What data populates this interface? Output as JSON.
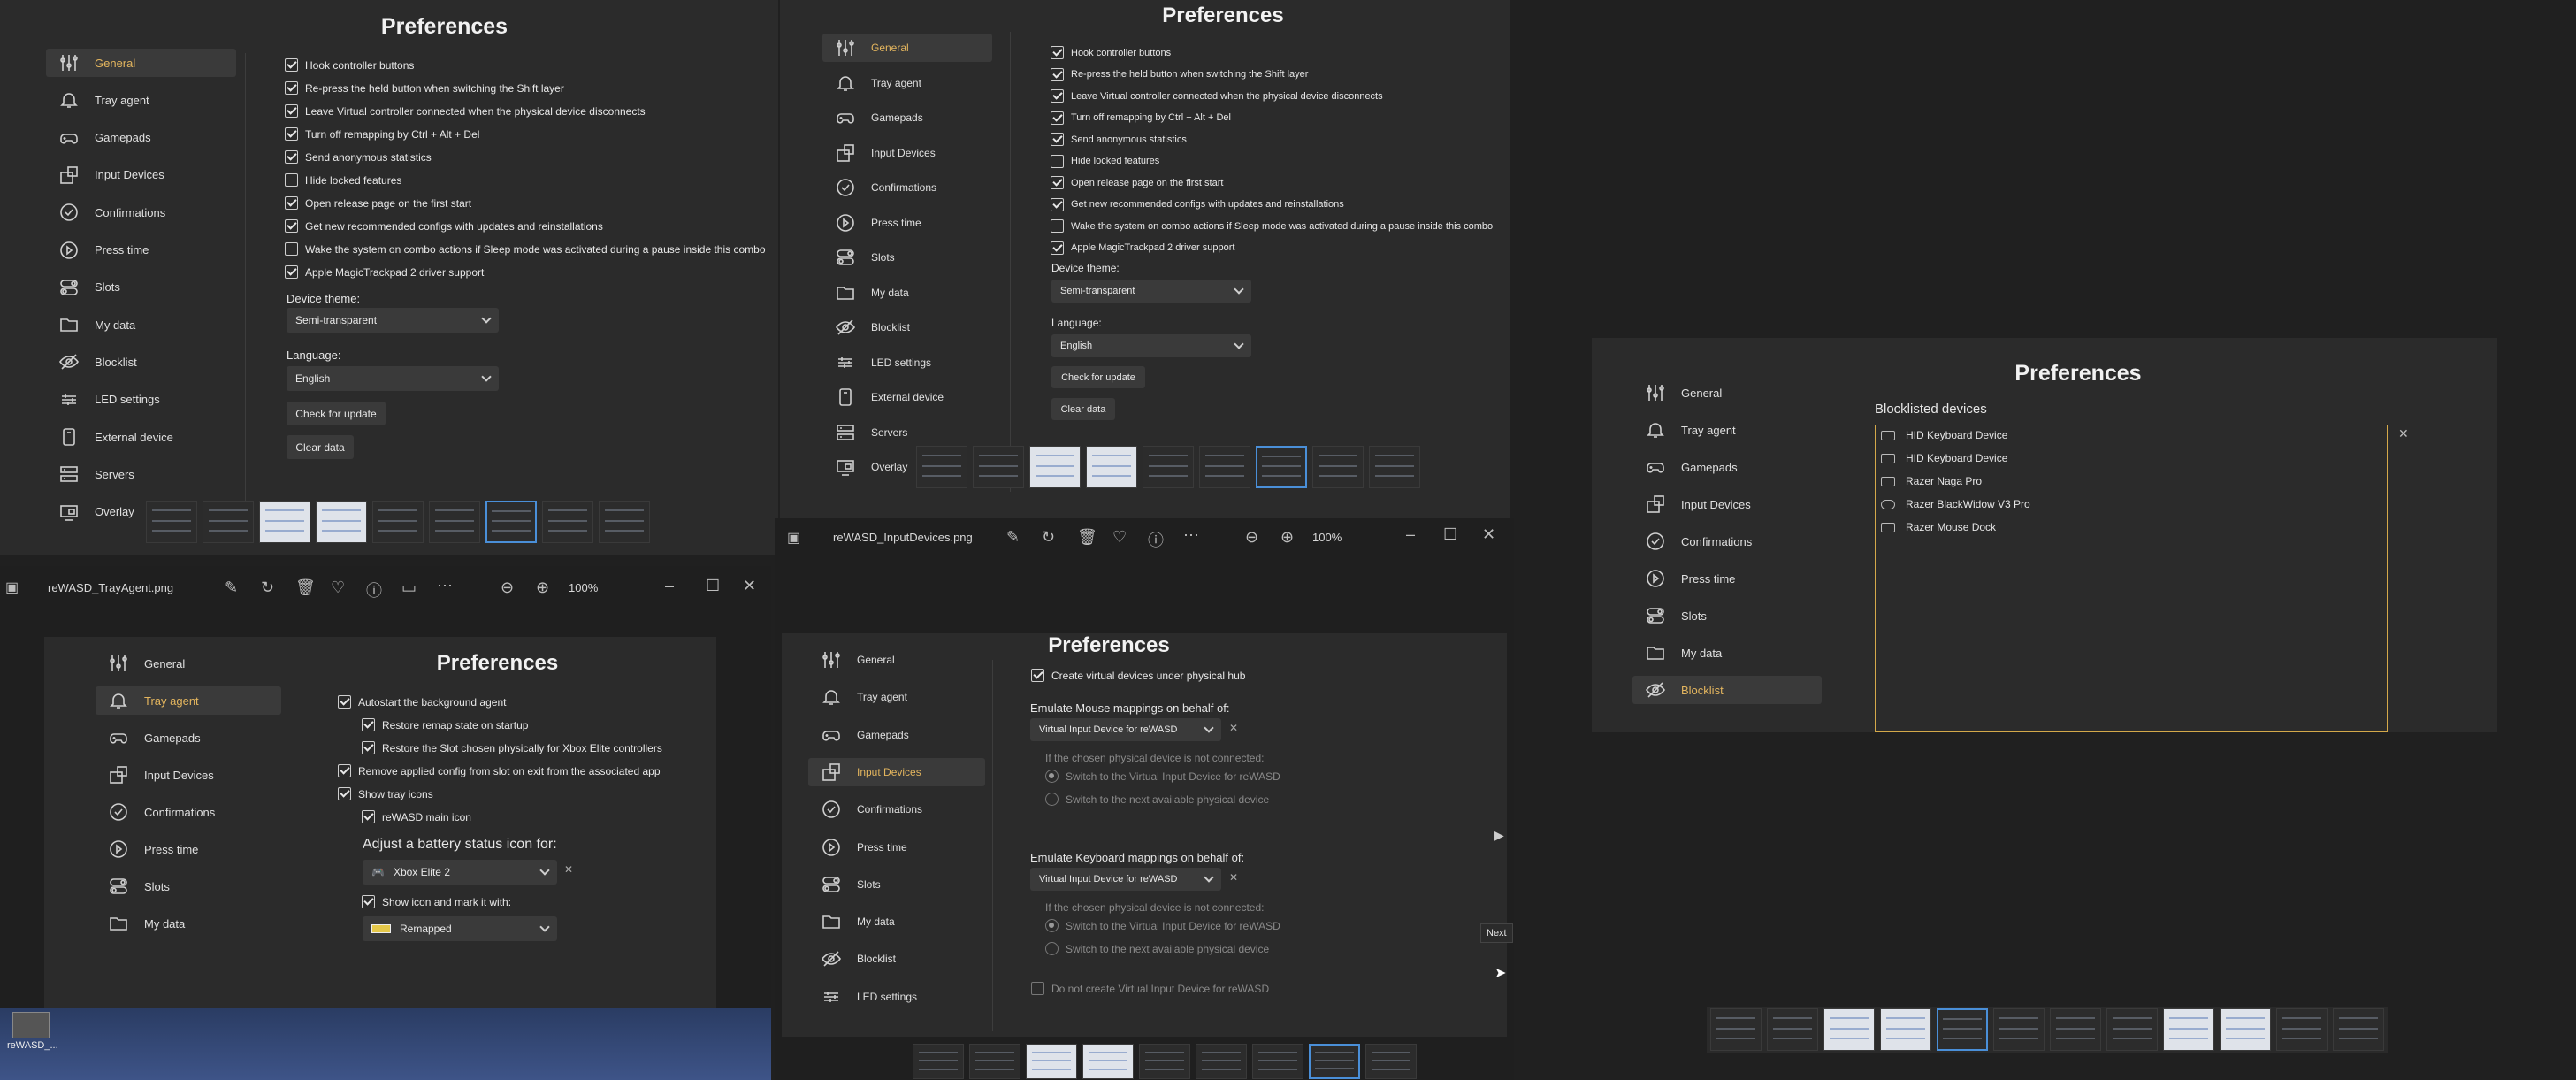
{
  "pref_title": "Preferences",
  "nav": {
    "general": "General",
    "tray": "Tray agent",
    "gamepads": "Gamepads",
    "input": "Input Devices",
    "confirm": "Confirmations",
    "press": "Press time",
    "slots": "Slots",
    "mydata": "My data",
    "blocklist": "Blocklist",
    "led": "LED settings",
    "external": "External device",
    "servers": "Servers",
    "overlay": "Overlay"
  },
  "general": {
    "options": [
      {
        "label": "Hook controller buttons",
        "checked": true
      },
      {
        "label": "Re-press the held button when switching the Shift layer",
        "checked": true
      },
      {
        "label": "Leave Virtual controller connected when the physical device disconnects",
        "checked": true
      },
      {
        "label": "Turn off remapping by Ctrl + Alt + Del",
        "checked": true
      },
      {
        "label": "Send anonymous statistics",
        "checked": true
      },
      {
        "label": "Hide locked features",
        "checked": false
      },
      {
        "label": "Open release page on the first start",
        "checked": true
      },
      {
        "label": "Get new recommended configs with updates and reinstallations",
        "checked": true
      },
      {
        "label": "Wake the system on combo actions if Sleep mode was activated during a pause inside this combo",
        "checked": false
      },
      {
        "label": "Apple MagicTrackpad 2 driver support",
        "checked": true
      }
    ],
    "theme_label": "Device theme:",
    "theme_value": "Semi-transparent",
    "language_label": "Language:",
    "language_value": "English",
    "check_update": "Check for update",
    "clear_data": "Clear data"
  },
  "tray": {
    "window_file": "reWASD_TrayAgent.png",
    "zoom": "100%",
    "autostart": "Autostart the background agent",
    "restore_remap": "Restore remap state on startup",
    "restore_slot": "Restore the Slot chosen physically for Xbox Elite controllers",
    "remove_config": "Remove applied config from slot on exit from the associated app",
    "show_tray": "Show tray icons",
    "main_icon": "reWASD main icon",
    "battery_heading": "Adjust a battery status icon for:",
    "battery_device": "Xbox Elite 2",
    "show_icon_mark": "Show icon and mark it with:",
    "mark_value": "Remapped"
  },
  "input": {
    "window_file": "reWASD_InputDevices.png",
    "zoom": "100%",
    "create_virtual": "Create virtual devices under physical hub",
    "mouse_heading": "Emulate Mouse mappings on behalf of:",
    "mouse_value": "Virtual Input Device for reWASD",
    "not_connected": "If the chosen physical device is not connected:",
    "switch_virtual": "Switch to the Virtual Input Device for reWASD",
    "switch_next": "Switch to the next available physical device",
    "keyboard_heading": "Emulate Keyboard mappings on behalf of:",
    "keyboard_value": "Virtual Input Device for reWASD",
    "do_not_create": "Do not create Virtual Input Device for reWASD",
    "next_tooltip": "Next"
  },
  "blocklist": {
    "heading": "Blocklisted devices",
    "devices": [
      "HID Keyboard Device",
      "HID Keyboard Device",
      "Razer Naga Pro",
      "Razer BlackWidow V3 Pro",
      "Razer Mouse Dock"
    ]
  },
  "taskbar": {
    "label": "reWASD_..."
  },
  "colors": {
    "accent": "#e3b55e",
    "selection": "#4a8fd8",
    "background": "#202020",
    "panel": "#2b2b2b"
  }
}
